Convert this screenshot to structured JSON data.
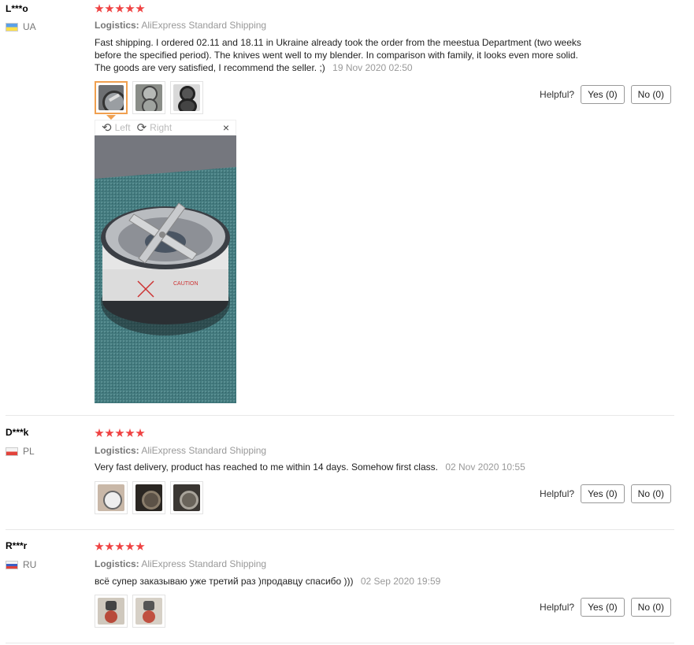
{
  "reviews": [
    {
      "user": "L***o",
      "country": "UA",
      "rating": 5,
      "logistics_label": "Logistics:",
      "logistics_value": "AliExpress Standard Shipping",
      "text": "Fast shipping. I ordered 02.11 and 18.11 in Ukraine already took the order from the meestua Department (two weeks before the specified period). The knives went well to my blender. In comparison with family, it looks even more solid. The goods are very satisfied, I recommend the seller. ;)",
      "date": "19 Nov 2020 02:50",
      "helpful_label": "Helpful?",
      "yes_label": "Yes (0)",
      "no_label": "No (0)"
    },
    {
      "user": "D***k",
      "country": "PL",
      "rating": 5,
      "logistics_label": "Logistics:",
      "logistics_value": "AliExpress Standard Shipping",
      "text": "Very fast delivery, product has reached to me within 14 days. Somehow first class.",
      "date": "02 Nov 2020 10:55",
      "helpful_label": "Helpful?",
      "yes_label": "Yes (0)",
      "no_label": "No (0)"
    },
    {
      "user": "R***r",
      "country": "RU",
      "rating": 5,
      "logistics_label": "Logistics:",
      "logistics_value": "AliExpress Standard Shipping",
      "text": "всё супер заказываю уже третий раз )продавцу спасибо )))",
      "date": "02 Sep 2020 19:59",
      "helpful_label": "Helpful?",
      "yes_label": "Yes (0)",
      "no_label": "No (0)"
    }
  ],
  "viewer": {
    "rotate_left_label": "Left",
    "rotate_right_label": "Right",
    "close_icon": "×"
  },
  "colors": {
    "star": "#ef4242",
    "active_thumb_border": "#f0a050"
  }
}
